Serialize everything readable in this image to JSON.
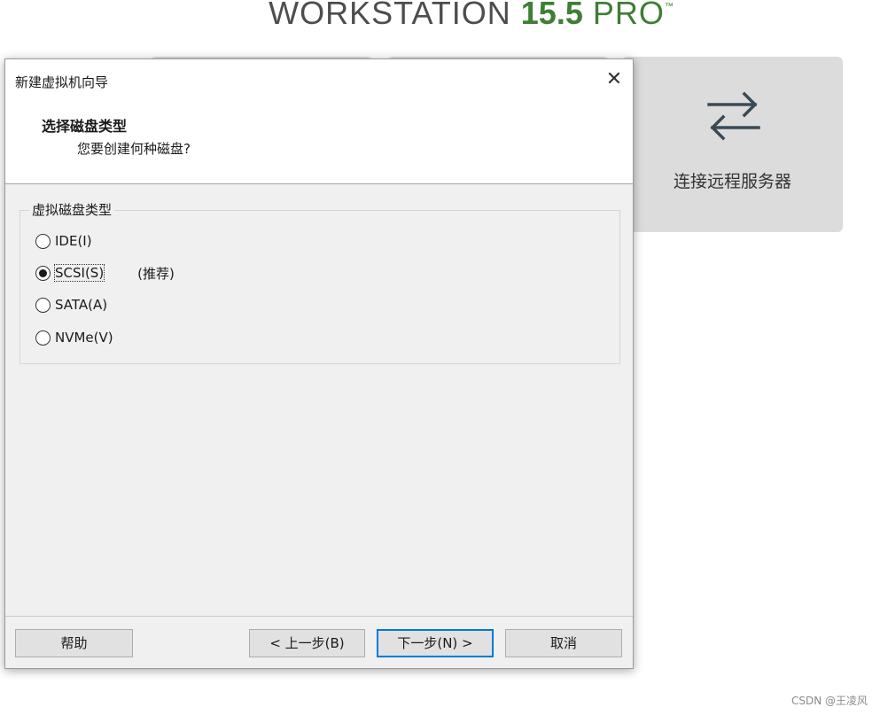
{
  "background": {
    "brand_main": "WORKSTATION ",
    "brand_version": "15.5",
    "brand_suffix": " PRO",
    "brand_tm": "™",
    "remote_card_label": "连接远程服务器",
    "remote_card_icon": "swap-arrows-icon",
    "watermark": "CSDN @王凌风"
  },
  "dialog": {
    "title": "新建虚拟机向导",
    "close_glyph": "✕",
    "section_title": "选择磁盘类型",
    "section_subtitle": "您要创建何种磁盘?",
    "group_label": "虚拟磁盘类型",
    "options": [
      {
        "label": "IDE(I)",
        "checked": false
      },
      {
        "label": "SCSI(S)",
        "checked": true,
        "note": "(推荐)"
      },
      {
        "label": "SATA(A)",
        "checked": false
      },
      {
        "label": "NVMe(V)",
        "checked": false
      }
    ],
    "buttons": {
      "help": "帮助",
      "prev": "< 上一步(B)",
      "next": "下一步(N) >",
      "cancel": "取消"
    }
  },
  "colors": {
    "brand_green": "#3f7e35",
    "focus_blue": "#0078d7",
    "dialog_bg": "#f0f0f0",
    "card_bg": "#dcdcdc"
  }
}
